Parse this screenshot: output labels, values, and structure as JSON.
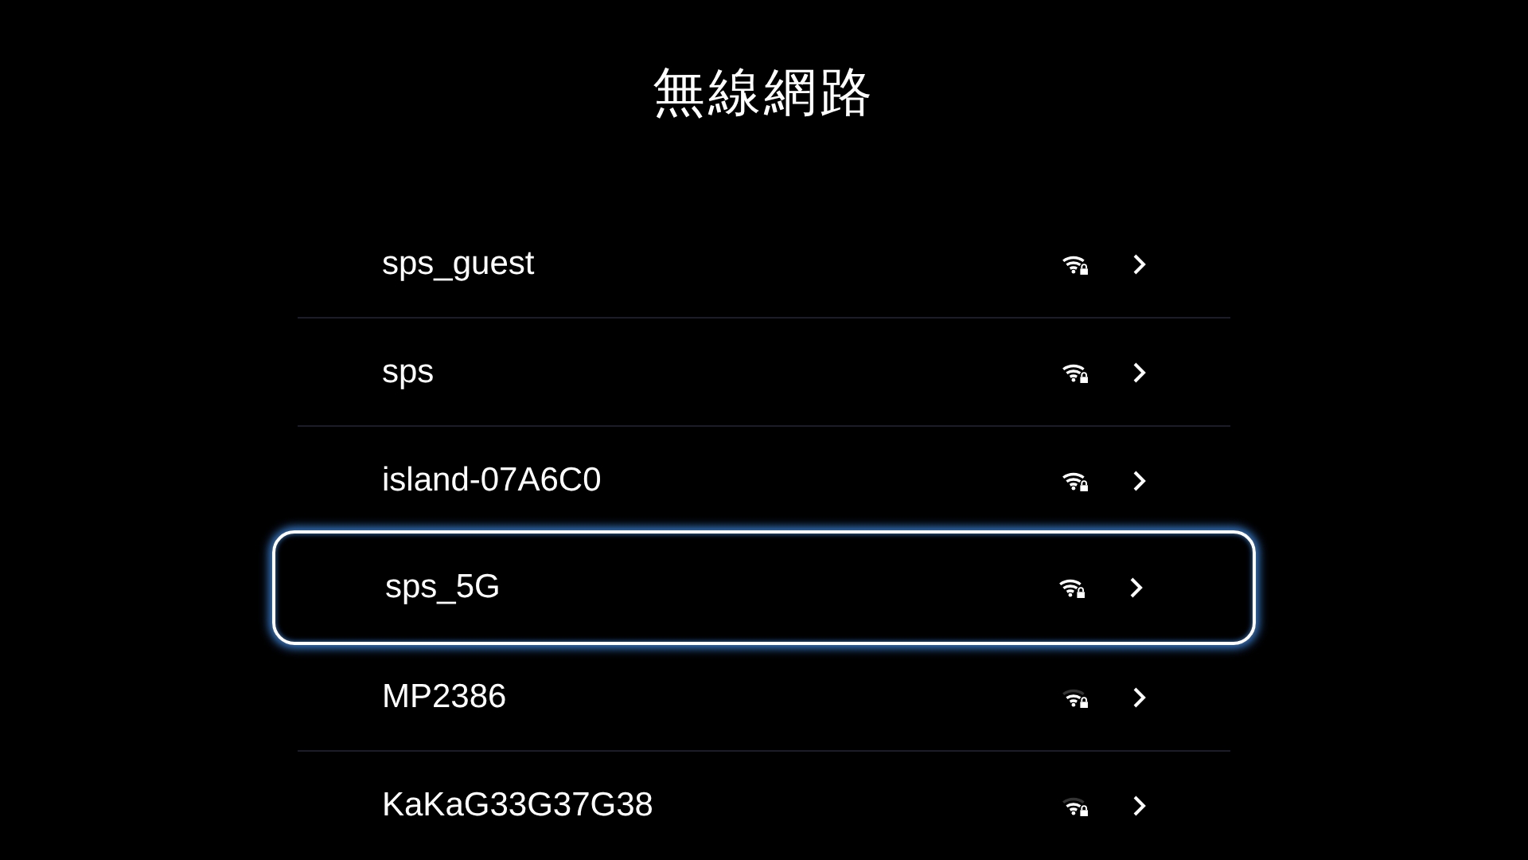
{
  "title": "無線網路",
  "networks": [
    {
      "name": "sps_guest",
      "selected": false,
      "kind": "full"
    },
    {
      "name": "sps",
      "selected": false,
      "kind": "full"
    },
    {
      "name": "island-07A6C0",
      "selected": false,
      "kind": "full"
    },
    {
      "name": "sps_5G",
      "selected": true,
      "kind": "full"
    },
    {
      "name": "MP2386",
      "selected": false,
      "kind": "weak"
    },
    {
      "name": "KaKaG33G37G38",
      "selected": false,
      "kind": "weak"
    }
  ]
}
